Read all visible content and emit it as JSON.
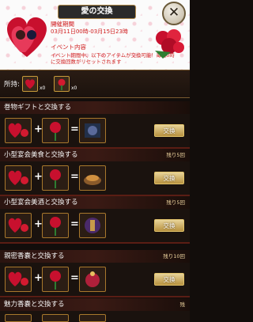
{
  "header": {
    "title": "愛の交換",
    "close_icon": "x-close-icon",
    "period_label": "開催期間",
    "period_value": "03月11日00時-03月15日23時",
    "event_label": "イベント内容",
    "event_desc": "イベント期間中、以下のアイテムが交換可能！毎日0時に交換回数がリセットされます"
  },
  "holdings": {
    "label": "所持:",
    "items": [
      {
        "icon": "heart-box-icon",
        "count": "x0"
      },
      {
        "icon": "rose-icon",
        "count": "x0"
      }
    ]
  },
  "exchanges": [
    {
      "title": "巻物ギフトと交換する",
      "remaining": "",
      "button": "交換"
    },
    {
      "title": "小型宴会美食と交換する",
      "remaining": "残り5回",
      "button": "交換"
    },
    {
      "title": "小型宴会美酒と交換する",
      "remaining": "残り5回",
      "button": "交換"
    },
    {
      "title": "親密香嚢と交換する",
      "remaining": "残り10回",
      "button": "交換"
    },
    {
      "title": "魅力香嚢と交換する",
      "remaining": "残",
      "button": ""
    }
  ],
  "colors": {
    "accent_red": "#d02020",
    "gold": "#c79a3a",
    "button_gold": "#e8d49a"
  }
}
